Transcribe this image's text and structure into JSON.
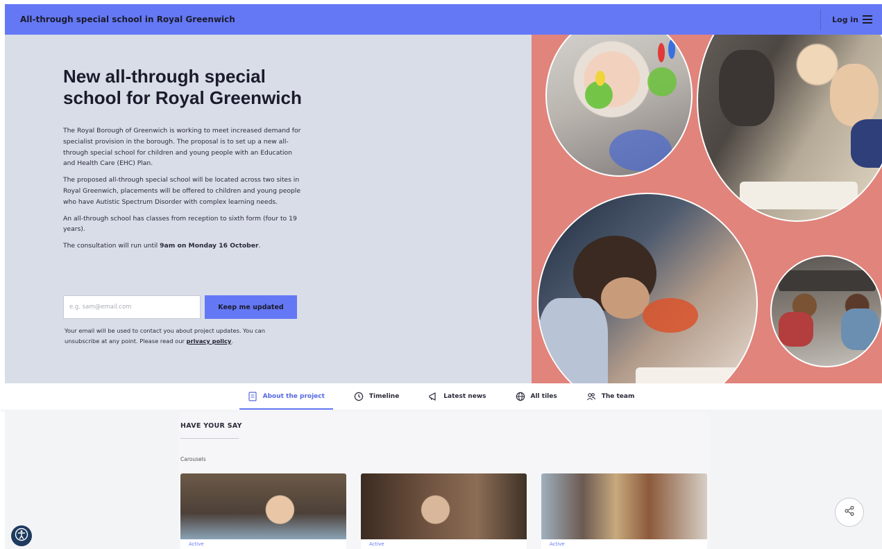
{
  "header": {
    "site_title": "All-through special school in Royal Greenwich",
    "login_label": "Log in",
    "menu_icon": "hamburger-icon"
  },
  "hero": {
    "title": "New all-through special school for Royal Greenwich",
    "paragraphs": [
      "The Royal Borough of Greenwich is working to meet increased demand for specialist provision in the borough. The proposal is to set up a new all-through special school for children and young people with an Education and Health Care (EHC) Plan.",
      "The proposed all-through special school will be located across two sites in Royal Greenwich, placements will be offered to children and young people who have Autistic Spectrum Disorder with complex learning needs.",
      "An all-through school has classes from reception to sixth form (four to 19 years)."
    ],
    "deadline_prefix": "The consultation will run until ",
    "deadline_bold": "9am on Monday 16 October",
    "deadline_suffix": ".",
    "email_placeholder": "e.g. sam@email.com",
    "subscribe_label": "Keep me updated",
    "privacy_text": "Your email will be used to contact you about project updates. You can unsubscribe at any point. Please read our ",
    "privacy_link": "privacy policy",
    "privacy_end": ".",
    "accent_color": "#6478f5",
    "right_panel_color": "#e1847c"
  },
  "tabs": [
    {
      "label": "About the project",
      "icon": "document-icon",
      "active": true
    },
    {
      "label": "Timeline",
      "icon": "clock-icon",
      "active": false
    },
    {
      "label": "Latest news",
      "icon": "megaphone-icon",
      "active": false
    },
    {
      "label": "All tiles",
      "icon": "globe-icon",
      "active": false
    },
    {
      "label": "The team",
      "icon": "team-icon",
      "active": false
    }
  ],
  "have_your_say": {
    "title": "HAVE YOUR SAY",
    "group_label": "Carousels",
    "cards": [
      {
        "status": "Active"
      },
      {
        "status": "Active"
      },
      {
        "status": "Active"
      }
    ]
  },
  "floating": {
    "share_icon": "share-icon",
    "accessibility_icon": "accessibility-icon"
  }
}
